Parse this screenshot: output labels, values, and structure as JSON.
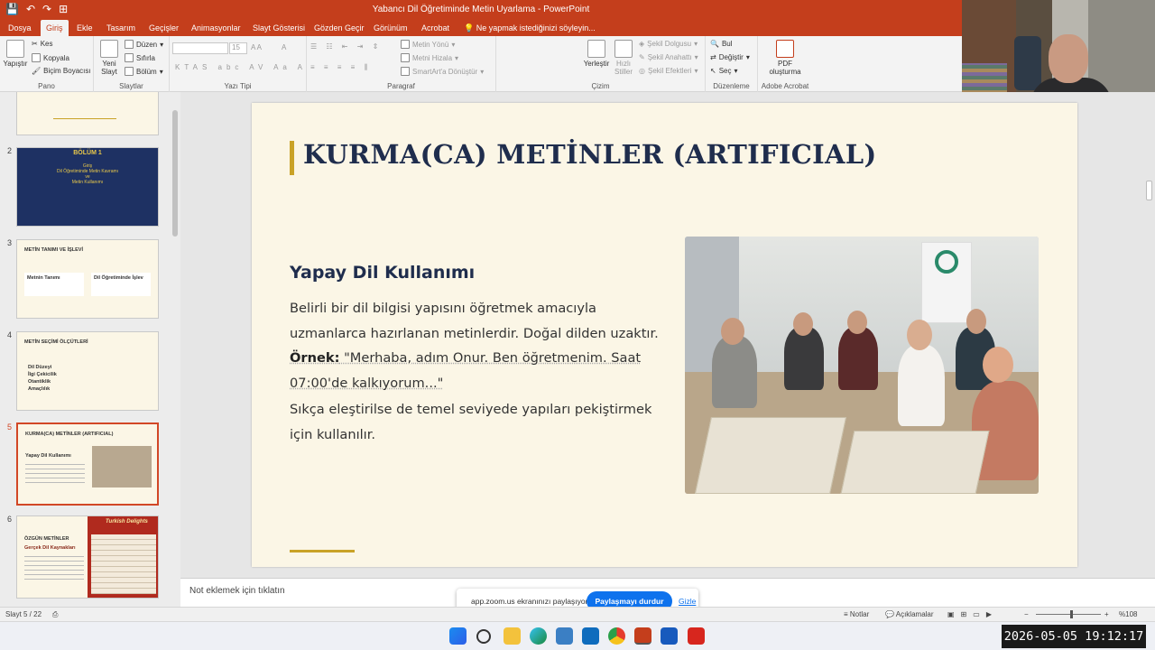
{
  "window": {
    "title": "Yabancı Dil Öğretiminde Metin Uyarlama - PowerPoint",
    "qat": [
      "💾",
      "↶",
      "↷",
      "⊞"
    ]
  },
  "tabs": [
    "Dosya",
    "Giriş",
    "Ekle",
    "Tasarım",
    "Geçişler",
    "Animasyonlar",
    "Slayt Gösterisi",
    "Gözden Geçir",
    "Görünüm",
    "Acrobat"
  ],
  "tell_me": "Ne yapmak istediğinizi söyleyin...",
  "ribbon": {
    "clipboard": {
      "paste": "Yapıştır",
      "cut": "Kes",
      "copy": "Kopyala",
      "format_painter": "Biçim Boyacısı",
      "label": "Pano"
    },
    "slides": {
      "new_slide": "Yeni Slayt",
      "layout": "Düzen",
      "reset": "Sıfırla",
      "section": "Bölüm",
      "label": "Slaytlar"
    },
    "font": {
      "size": "15",
      "label": "Yazı Tipi"
    },
    "paragraph": {
      "text_direction": "Metin Yönü",
      "align_text": "Metni Hizala",
      "smartart": "SmartArt'a Dönüştür",
      "label": "Paragraf"
    },
    "drawing": {
      "arrange": "Yerleştir",
      "quick_styles": "Hızlı Stiller",
      "fill": "Şekil Dolgusu",
      "outline": "Şekil Anahattı",
      "effects": "Şekil Efektleri",
      "label": "Çizim"
    },
    "editing": {
      "find": "Bul",
      "replace": "Değiştir",
      "select": "Seç",
      "label": "Düzenleme"
    },
    "acrobat": {
      "create_pdf": "PDF oluşturma",
      "label": "Adobe Acrobat"
    }
  },
  "thumbnails": [
    {
      "number": "2",
      "title": "BÖLÜM 1",
      "lines": [
        "Giriş",
        "Dil Öğretiminde Metin Kavramı",
        "ve",
        "Metin Kullanımı"
      ]
    },
    {
      "number": "3",
      "title": "METİN TANIMI VE İŞLEVİ",
      "lines": [
        "Metnin Tanımı",
        "Dil Öğretiminde İşlev"
      ]
    },
    {
      "number": "4",
      "title": "METİN SEÇİMİ ÖLÇÜTLERİ",
      "lines": [
        "Dil Düzeyi",
        "İlgi Çekicilik",
        "Otantiklik",
        "Amaçlılık"
      ]
    },
    {
      "number": "5",
      "title": "KURMA(CA) METİNLER (ARTIFICIAL)",
      "lines": [
        "Yapay Dil Kullanımı"
      ]
    },
    {
      "number": "6",
      "title": "ÖZGÜN METİNLER",
      "lines": [
        "Gerçek Dil Kaynakları"
      ]
    }
  ],
  "thumb6_banner": "Turkish Delights",
  "slide": {
    "title": "KURMA(CA) METİNLER (ARTIFICIAL)",
    "subtitle": "Yapay Dil Kullanımı",
    "p1": "Belirli bir dil bilgisi yapısını öğretmek amacıyla uzmanlarca hazırlanan metinlerdir. Doğal dilden uzaktır.",
    "example_label": "Örnek:",
    "example_text": " \"Merhaba, adım Onur. Ben öğretmenim. Saat 07:00'de kalkıyorum...\"",
    "p3": "Sıkça eleştirilse de temel seviyede yapıları pekiştirmek için kullanılır."
  },
  "notes_placeholder": "Not eklemek için tıklatın",
  "zoom_share": {
    "message": "app.zoom.us ekranınızı paylaşıyor.",
    "stop": "Paylaşmayı durdur",
    "hide": "Gizle"
  },
  "status": {
    "slide": "Slayt 5 / 22",
    "notes": "Notlar",
    "comments": "Açıklamalar",
    "zoom": "%108"
  },
  "clock": "2026-05-05  19:12:17",
  "colors": {
    "accent": "#c43e1c",
    "gold": "#c9a227",
    "navy": "#1f2d4d",
    "zoom_blue": "#0e72ed"
  }
}
